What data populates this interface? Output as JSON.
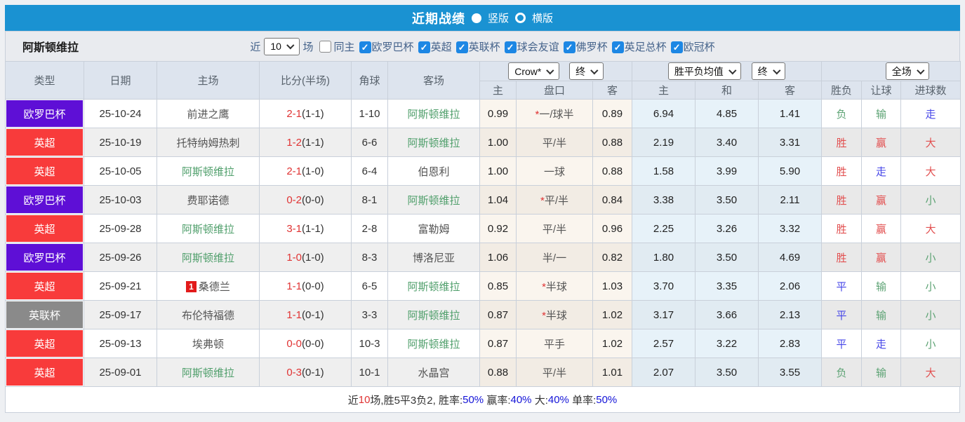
{
  "titlebar": {
    "title": "近期战绩",
    "radio_vertical_label": "竖版",
    "radio_horizontal_label": "横版",
    "radio_selected": "竖版"
  },
  "filter": {
    "team": "阿斯顿维拉",
    "recent_label": "近",
    "recent_value": "10",
    "games_label": "场",
    "same_home_label": "同主",
    "same_home_checked": false,
    "competitions": [
      "欧罗巴杯",
      "英超",
      "英联杯",
      "球会友谊",
      "佛罗杯",
      "英足总杯",
      "欧冠杯"
    ]
  },
  "table": {
    "left_headers": [
      "类型",
      "日期",
      "主场",
      "比分(半场)",
      "角球",
      "客场"
    ],
    "dropdowns": {
      "odds_company": "Crow*",
      "odds_time_1": "终",
      "wdl_label": "胜平负均值",
      "odds_time_2": "终",
      "scope": "全场"
    },
    "sub_headers": [
      "主",
      "盘口",
      "客",
      "主",
      "和",
      "客",
      "胜负",
      "让球",
      "进球数"
    ],
    "rows": [
      {
        "type": "欧罗巴杯",
        "date": "25-10-24",
        "home": "前进之鹰",
        "home_hl": false,
        "home_badge": "",
        "score": "2-1",
        "half": "(1-1)",
        "corners": "1-10",
        "away": "阿斯顿维拉",
        "away_hl": true,
        "odds": [
          "0.99",
          "一/球半",
          "0.89"
        ],
        "star": true,
        "wdl": [
          "6.94",
          "4.85",
          "1.41"
        ],
        "results": [
          [
            "负",
            "green"
          ],
          [
            "输",
            "green"
          ],
          [
            "走",
            "blue"
          ]
        ]
      },
      {
        "type": "英超",
        "date": "25-10-19",
        "home": "托特纳姆热刺",
        "home_hl": false,
        "home_badge": "",
        "score": "1-2",
        "half": "(1-1)",
        "corners": "6-6",
        "away": "阿斯顿维拉",
        "away_hl": true,
        "odds": [
          "1.00",
          "平/半",
          "0.88"
        ],
        "star": false,
        "wdl": [
          "2.19",
          "3.40",
          "3.31"
        ],
        "results": [
          [
            "胜",
            "red"
          ],
          [
            "赢",
            "red"
          ],
          [
            "大",
            "red"
          ]
        ]
      },
      {
        "type": "英超",
        "date": "25-10-05",
        "home": "阿斯顿维拉",
        "home_hl": true,
        "home_badge": "",
        "score": "2-1",
        "half": "(1-0)",
        "corners": "6-4",
        "away": "伯恩利",
        "away_hl": false,
        "odds": [
          "1.00",
          "一球",
          "0.88"
        ],
        "star": false,
        "wdl": [
          "1.58",
          "3.99",
          "5.90"
        ],
        "results": [
          [
            "胜",
            "red"
          ],
          [
            "走",
            "blue"
          ],
          [
            "大",
            "red"
          ]
        ]
      },
      {
        "type": "欧罗巴杯",
        "date": "25-10-03",
        "home": "费耶诺德",
        "home_hl": false,
        "home_badge": "",
        "score": "0-2",
        "half": "(0-0)",
        "corners": "8-1",
        "away": "阿斯顿维拉",
        "away_hl": true,
        "odds": [
          "1.04",
          "平/半",
          "0.84"
        ],
        "star": true,
        "wdl": [
          "3.38",
          "3.50",
          "2.11"
        ],
        "results": [
          [
            "胜",
            "red"
          ],
          [
            "赢",
            "red"
          ],
          [
            "小",
            "green"
          ]
        ]
      },
      {
        "type": "英超",
        "date": "25-09-28",
        "home": "阿斯顿维拉",
        "home_hl": true,
        "home_badge": "",
        "score": "3-1",
        "half": "(1-1)",
        "corners": "2-8",
        "away": "富勒姆",
        "away_hl": false,
        "odds": [
          "0.92",
          "平/半",
          "0.96"
        ],
        "star": false,
        "wdl": [
          "2.25",
          "3.26",
          "3.32"
        ],
        "results": [
          [
            "胜",
            "red"
          ],
          [
            "赢",
            "red"
          ],
          [
            "大",
            "red"
          ]
        ]
      },
      {
        "type": "欧罗巴杯",
        "date": "25-09-26",
        "home": "阿斯顿维拉",
        "home_hl": true,
        "home_badge": "",
        "score": "1-0",
        "half": "(1-0)",
        "corners": "8-3",
        "away": "博洛尼亚",
        "away_hl": false,
        "odds": [
          "1.06",
          "半/一",
          "0.82"
        ],
        "star": false,
        "wdl": [
          "1.80",
          "3.50",
          "4.69"
        ],
        "results": [
          [
            "胜",
            "red"
          ],
          [
            "赢",
            "red"
          ],
          [
            "小",
            "green"
          ]
        ]
      },
      {
        "type": "英超",
        "date": "25-09-21",
        "home": "桑德兰",
        "home_hl": false,
        "home_badge": "1",
        "score": "1-1",
        "half": "(0-0)",
        "corners": "6-5",
        "away": "阿斯顿维拉",
        "away_hl": true,
        "odds": [
          "0.85",
          "半球",
          "1.03"
        ],
        "star": true,
        "wdl": [
          "3.70",
          "3.35",
          "2.06"
        ],
        "results": [
          [
            "平",
            "blue"
          ],
          [
            "输",
            "green"
          ],
          [
            "小",
            "green"
          ]
        ]
      },
      {
        "type": "英联杯",
        "date": "25-09-17",
        "home": "布伦特福德",
        "home_hl": false,
        "home_badge": "",
        "score": "1-1",
        "half": "(0-1)",
        "corners": "3-3",
        "away": "阿斯顿维拉",
        "away_hl": true,
        "odds": [
          "0.87",
          "半球",
          "1.02"
        ],
        "star": true,
        "wdl": [
          "3.17",
          "3.66",
          "2.13"
        ],
        "results": [
          [
            "平",
            "blue"
          ],
          [
            "输",
            "green"
          ],
          [
            "小",
            "green"
          ]
        ]
      },
      {
        "type": "英超",
        "date": "25-09-13",
        "home": "埃弗顿",
        "home_hl": false,
        "home_badge": "",
        "score": "0-0",
        "half": "(0-0)",
        "corners": "10-3",
        "away": "阿斯顿维拉",
        "away_hl": true,
        "odds": [
          "0.87",
          "平手",
          "1.02"
        ],
        "star": false,
        "wdl": [
          "2.57",
          "3.22",
          "2.83"
        ],
        "results": [
          [
            "平",
            "blue"
          ],
          [
            "走",
            "blue"
          ],
          [
            "小",
            "green"
          ]
        ]
      },
      {
        "type": "英超",
        "date": "25-09-01",
        "home": "阿斯顿维拉",
        "home_hl": true,
        "home_badge": "",
        "score": "0-3",
        "half": "(0-1)",
        "corners": "10-1",
        "away": "水晶宫",
        "away_hl": false,
        "odds": [
          "0.88",
          "平/半",
          "1.01"
        ],
        "star": false,
        "wdl": [
          "2.07",
          "3.50",
          "3.55"
        ],
        "results": [
          [
            "负",
            "green"
          ],
          [
            "输",
            "green"
          ],
          [
            "大",
            "red"
          ]
        ]
      }
    ]
  },
  "footer": {
    "segments": [
      {
        "t": "近",
        "c": "dark"
      },
      {
        "t": "10",
        "c": "red"
      },
      {
        "t": "场,胜5平3负2, 胜率:",
        "c": "dark"
      },
      {
        "t": "50%",
        "c": "blue"
      },
      {
        "t": " 赢率:",
        "c": "dark"
      },
      {
        "t": "40%",
        "c": "blue"
      },
      {
        "t": " 大:",
        "c": "dark"
      },
      {
        "t": "40%",
        "c": "blue"
      },
      {
        "t": " 单率:",
        "c": "dark"
      },
      {
        "t": "50%",
        "c": "blue"
      }
    ]
  },
  "colors": {
    "titlebar_blue": "#1a92d2",
    "checkbox_blue": "#1d87e4",
    "type_badges": {
      "欧罗巴杯": "#5e0fd6",
      "英超": "#f83b3b",
      "英联杯": "#8a8a8a"
    },
    "team_highlight_green": "#4e9e6a",
    "score_red": "#e03333",
    "result_red": "#e25050",
    "result_blue": "#4646e8",
    "result_green": "#5da374",
    "footer_value_blue": "#1414d8",
    "header_bg": "#dde4ee"
  }
}
